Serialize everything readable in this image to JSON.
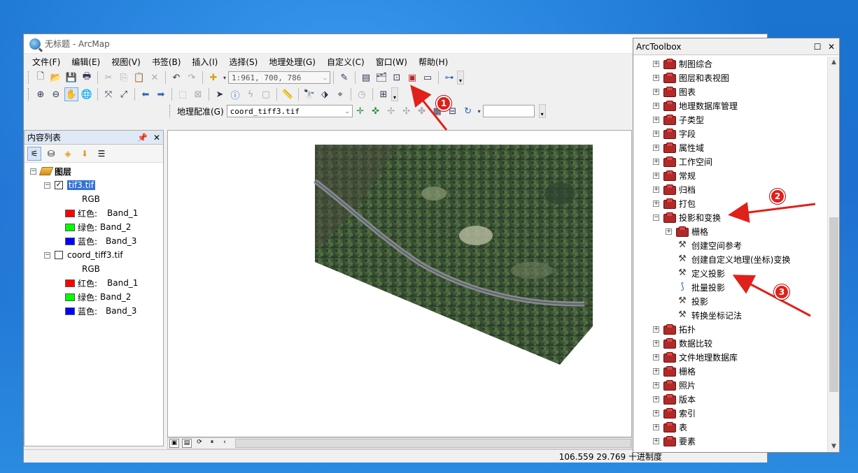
{
  "window": {
    "title": "无标题 - ArcMap"
  },
  "menu": [
    "文件(F)",
    "编辑(E)",
    "视图(V)",
    "书签(B)",
    "插入(I)",
    "选择(S)",
    "地理处理(G)",
    "自定义(C)",
    "窗口(W)",
    "帮助(H)"
  ],
  "toolbar": {
    "scale": "1:961, 700, 786"
  },
  "georef": {
    "label": "地理配准(G)",
    "layer": "coord_tiff3.tif"
  },
  "toc": {
    "title": "内容列表",
    "root": "图层",
    "layers": [
      {
        "name": "tif3.tif",
        "checked": true,
        "selected": true,
        "rgb": "RGB",
        "bands": [
          {
            "label": "红色:",
            "band": "Band_1",
            "color": "#ff0000"
          },
          {
            "label": "绿色:",
            "band": "Band_2",
            "color": "#00ff00"
          },
          {
            "label": "蓝色:",
            "band": "Band_3",
            "color": "#0000ff"
          }
        ]
      },
      {
        "name": "coord_tiff3.tif",
        "checked": false,
        "selected": false,
        "rgb": "RGB",
        "bands": [
          {
            "label": "红色:",
            "band": "Band_1",
            "color": "#ff0000"
          },
          {
            "label": "绿色:",
            "band": "Band_2",
            "color": "#00ff00"
          },
          {
            "label": "蓝色:",
            "band": "Band_3",
            "color": "#0000ff"
          }
        ]
      }
    ]
  },
  "status": {
    "coords": "106.559  29.769 十进制度"
  },
  "toolbox": {
    "title": "ArcToolbox",
    "items": [
      {
        "label": "制图综合",
        "type": "toolbox",
        "level": 0,
        "exp": "+"
      },
      {
        "label": "图层和表视图",
        "type": "toolbox",
        "level": 0,
        "exp": "+"
      },
      {
        "label": "图表",
        "type": "toolbox",
        "level": 0,
        "exp": "+"
      },
      {
        "label": "地理数据库管理",
        "type": "toolbox",
        "level": 0,
        "exp": "+"
      },
      {
        "label": "子类型",
        "type": "toolbox",
        "level": 0,
        "exp": "+"
      },
      {
        "label": "字段",
        "type": "toolbox",
        "level": 0,
        "exp": "+"
      },
      {
        "label": "属性域",
        "type": "toolbox",
        "level": 0,
        "exp": "+"
      },
      {
        "label": "工作空间",
        "type": "toolbox",
        "level": 0,
        "exp": "+"
      },
      {
        "label": "常规",
        "type": "toolbox",
        "level": 0,
        "exp": "+"
      },
      {
        "label": "归档",
        "type": "toolbox",
        "level": 0,
        "exp": "+"
      },
      {
        "label": "打包",
        "type": "toolbox",
        "level": 0,
        "exp": "+"
      },
      {
        "label": "投影和变换",
        "type": "toolbox",
        "level": 0,
        "exp": "−"
      },
      {
        "label": "栅格",
        "type": "toolbox",
        "level": 1,
        "exp": "+"
      },
      {
        "label": "创建空间参考",
        "type": "tool",
        "level": 1,
        "exp": ""
      },
      {
        "label": "创建自定义地理(坐标)变换",
        "type": "tool",
        "level": 1,
        "exp": ""
      },
      {
        "label": "定义投影",
        "type": "tool",
        "level": 1,
        "exp": ""
      },
      {
        "label": "批量投影",
        "type": "script",
        "level": 1,
        "exp": ""
      },
      {
        "label": "投影",
        "type": "tool",
        "level": 1,
        "exp": ""
      },
      {
        "label": "转换坐标记法",
        "type": "tool",
        "level": 1,
        "exp": ""
      },
      {
        "label": "拓扑",
        "type": "toolbox",
        "level": 0,
        "exp": "+"
      },
      {
        "label": "数据比较",
        "type": "toolbox",
        "level": 0,
        "exp": "+"
      },
      {
        "label": "文件地理数据库",
        "type": "toolbox",
        "level": 0,
        "exp": "+"
      },
      {
        "label": "栅格",
        "type": "toolbox",
        "level": 0,
        "exp": "+"
      },
      {
        "label": "照片",
        "type": "toolbox",
        "level": 0,
        "exp": "+"
      },
      {
        "label": "版本",
        "type": "toolbox",
        "level": 0,
        "exp": "+"
      },
      {
        "label": "索引",
        "type": "toolbox",
        "level": 0,
        "exp": "+"
      },
      {
        "label": "表",
        "type": "toolbox",
        "level": 0,
        "exp": "+"
      },
      {
        "label": "要素",
        "type": "toolbox",
        "level": 0,
        "exp": "+"
      }
    ]
  },
  "annotations": [
    "1",
    "2",
    "3"
  ],
  "colors": {
    "arrow": "#e0201a",
    "selection": "#3373d3",
    "desktop": "#1f6fd0"
  }
}
